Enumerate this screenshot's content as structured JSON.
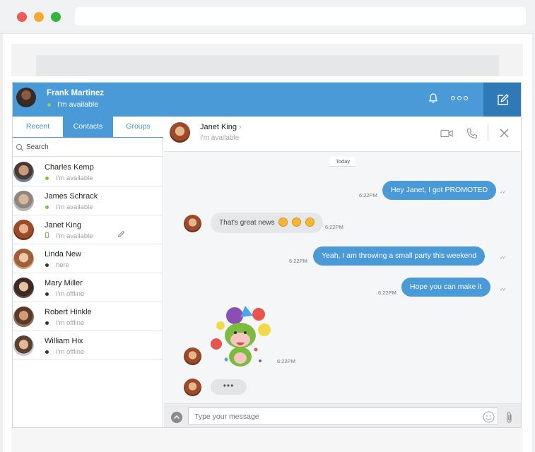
{
  "window": {
    "traffic_lights": [
      "close",
      "minimize",
      "maximize"
    ]
  },
  "colors": {
    "accent": "#4a9ad8",
    "accent_dark": "#2f79b7",
    "available": "#7cc142",
    "offline": "#333333",
    "incoming_bubble": "#e6e7e9"
  },
  "me": {
    "name": "Frank Martinez",
    "status": "I'm available"
  },
  "topbar": {
    "notifications_icon": "bell-icon",
    "more_icon": "more-icon",
    "compose_icon": "compose-icon"
  },
  "sidebar": {
    "tabs": [
      {
        "label": "Recent",
        "active": false
      },
      {
        "label": "Contacts",
        "active": true
      },
      {
        "label": "Groups",
        "active": false
      }
    ],
    "search_label": "Search",
    "contacts": [
      {
        "name": "Charles Kemp",
        "status": "I'm available",
        "presence": "available"
      },
      {
        "name": "James Schrack",
        "status": "I'm available",
        "presence": "available"
      },
      {
        "name": "Janet King",
        "status": "I'm available",
        "presence": "mobile",
        "selected": true
      },
      {
        "name": "Linda New",
        "status": "here",
        "presence": "offline"
      },
      {
        "name": "Mary Miller",
        "status": "I'm offline",
        "presence": "offline"
      },
      {
        "name": "Robert Hinkle",
        "status": "I'm offline",
        "presence": "offline"
      },
      {
        "name": "William Hix",
        "status": "I'm offline",
        "presence": "offline"
      }
    ]
  },
  "chat": {
    "contact_name": "Janet King",
    "contact_status": "I'm available",
    "date_divider": "Today",
    "messages": [
      {
        "direction": "out",
        "text": "Hey Janet, I got PROMOTED",
        "time": "6:22PM"
      },
      {
        "direction": "in",
        "text": "That's great news",
        "emojis": 3,
        "time": "6:22PM"
      },
      {
        "direction": "out",
        "text": "Yeah, I am throwing a small party this weekend",
        "time": "6:22PM"
      },
      {
        "direction": "out",
        "text": "Hope you can make it",
        "time": "6:22PM"
      },
      {
        "direction": "in",
        "type": "sticker",
        "sticker": "party-sticker",
        "time": "6:22PM"
      },
      {
        "direction": "in",
        "type": "typing",
        "text": "•••"
      }
    ],
    "composer_placeholder": "Type your message"
  }
}
